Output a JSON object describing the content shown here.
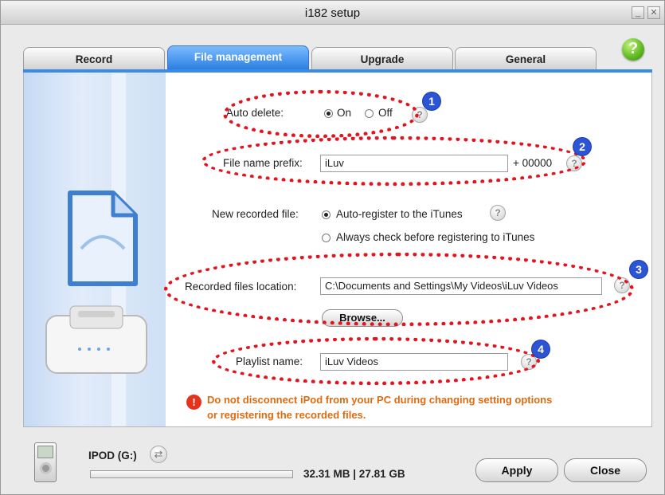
{
  "window": {
    "title": "i182 setup",
    "minimize_glyph": "_",
    "close_glyph": "✕"
  },
  "help_glyph": "?",
  "tabs": [
    {
      "label": "Record",
      "active": false
    },
    {
      "label": "File management",
      "active": true
    },
    {
      "label": "Upgrade",
      "active": false
    },
    {
      "label": "General",
      "active": false
    }
  ],
  "settings": {
    "auto_delete": {
      "label": "Auto delete:",
      "on": "On",
      "off": "Off",
      "selected": "On"
    },
    "prefix": {
      "label": "File name prefix:",
      "value": "iLuv",
      "suffix": "+ 00000"
    },
    "new_recorded": {
      "label": "New recorded file:",
      "option1": "Auto-register to the iTunes",
      "option2": "Always check before registering to iTunes",
      "selected": "option1"
    },
    "location": {
      "label": "Recorded files location:",
      "value": "C:\\Documents and Settings\\My Videos\\iLuv Videos",
      "browse": "Browse..."
    },
    "playlist": {
      "label": "Playlist name:",
      "value": "iLuv Videos"
    },
    "help_glyph": "?"
  },
  "callouts": [
    "1",
    "2",
    "3",
    "4"
  ],
  "warning": {
    "icon": "!",
    "line1": "Do not disconnect iPod from your PC during changing setting options",
    "line2": "or registering the recorded files."
  },
  "footer": {
    "device": "IPOD (G:)",
    "sync_glyph": "⇄",
    "storage": "32.31 MB | 27.81 GB",
    "progress_fraction": 0.001,
    "apply": "Apply",
    "close": "Close"
  },
  "colors": {
    "accent": "#2b7fe0",
    "callout": "#e4141f",
    "warning": "#e06a10",
    "badge": "#2b55d4"
  }
}
